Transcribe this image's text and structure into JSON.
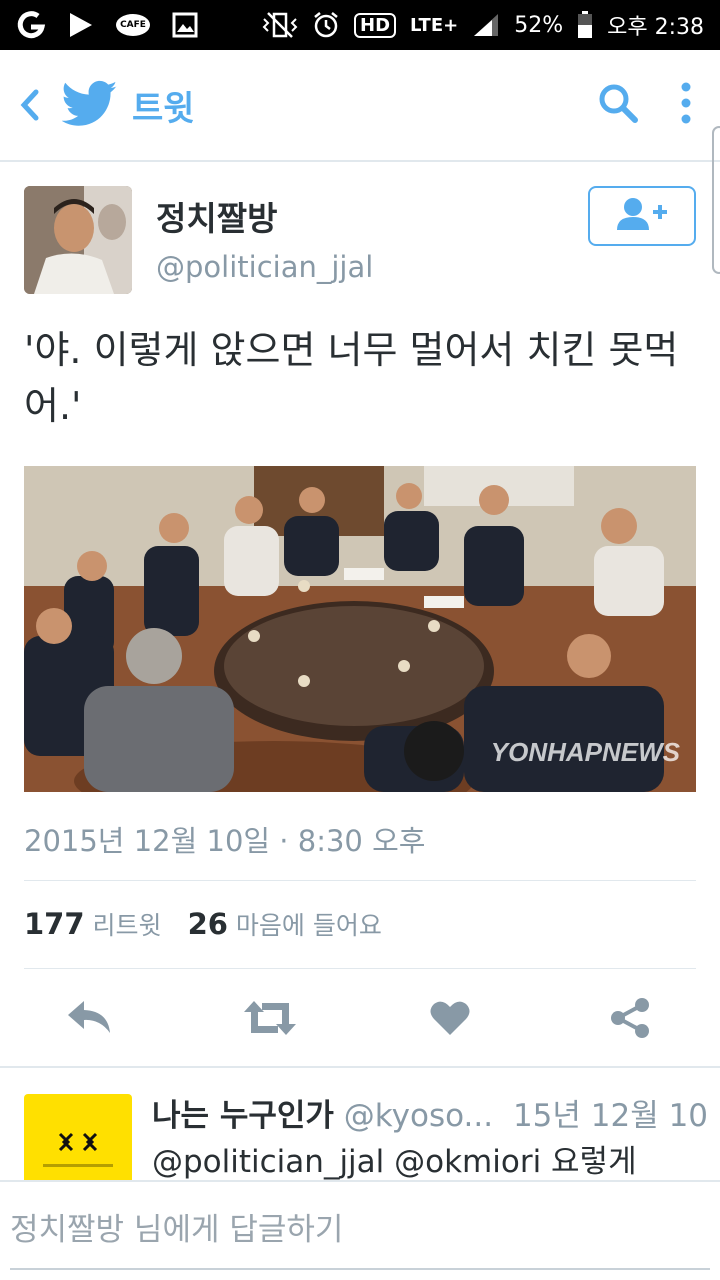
{
  "status_bar": {
    "cafe_label": "CAFE",
    "hd_label": "HD",
    "network": "LTE+",
    "battery": "52%",
    "time": "오후 2:38"
  },
  "app_bar": {
    "title": "트윗"
  },
  "tweet": {
    "user_name": "정치짤방",
    "user_handle": "@politician_jjal",
    "text": "'야. 이렇게 앉으면 너무 멀어서 치킨 못먹어.'",
    "photo_watermark": "YONHAPNEWS",
    "timestamp": "2015년 12월 10일 · 8:30 오후",
    "retweet_count": "177",
    "retweet_label": "리트윗",
    "like_count": "26",
    "like_label": "마음에 들어요"
  },
  "reply": {
    "name": "나는 누구인가",
    "handle": "@kyoso...",
    "date": "15년 12월 10일",
    "text": "@politician_jjal @okmiori 요렇게"
  },
  "compose": {
    "placeholder": "정치짤방 님에게 답글하기"
  },
  "colors": {
    "accent": "#55acee",
    "text": "#292f33",
    "muted": "#8899a6",
    "action_icon": "#8899a6"
  }
}
